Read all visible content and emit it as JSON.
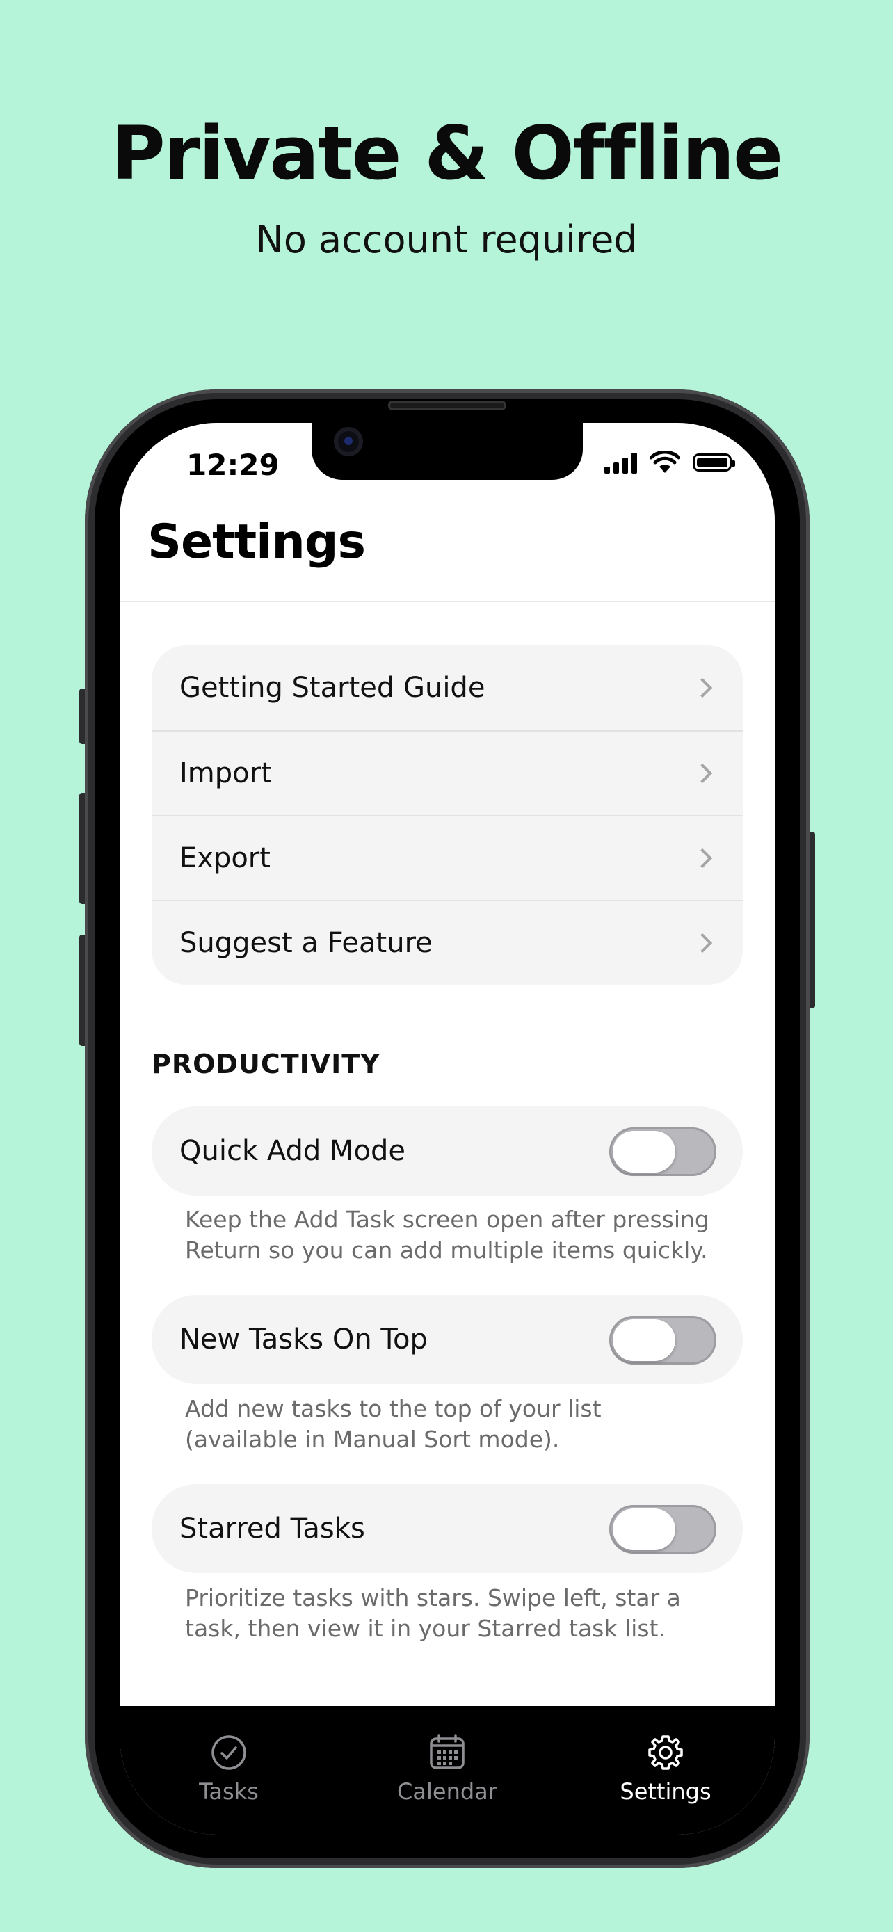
{
  "promo": {
    "headline": "Private & Offline",
    "subhead": "No account required"
  },
  "status_bar": {
    "time": "12:29",
    "icons": [
      "cellular-signal-icon",
      "wifi-icon",
      "battery-icon"
    ]
  },
  "screen": {
    "title": "Settings",
    "menu_items": [
      {
        "label": "Getting Started Guide",
        "icon": "chevron-right-icon"
      },
      {
        "label": "Import",
        "icon": "chevron-right-icon"
      },
      {
        "label": "Export",
        "icon": "chevron-right-icon"
      },
      {
        "label": "Suggest a Feature",
        "icon": "chevron-right-icon"
      }
    ],
    "productivity": {
      "header": "PRODUCTIVITY",
      "settings": [
        {
          "label": "Quick Add Mode",
          "enabled": false,
          "note": "Keep the Add Task screen open after pressing Return so you can add multiple items quickly."
        },
        {
          "label": "New Tasks On Top",
          "enabled": false,
          "note": "Add new tasks to the top of your list (available in Manual Sort mode)."
        },
        {
          "label": "Starred Tasks",
          "enabled": false,
          "note": "Prioritize tasks with stars. Swipe left, star a task, then view it in your Starred task list."
        }
      ]
    }
  },
  "tab_bar": {
    "tabs": [
      {
        "label": "Tasks",
        "icon": "checkmark-circle-icon",
        "active": false
      },
      {
        "label": "Calendar",
        "icon": "calendar-icon",
        "active": false
      },
      {
        "label": "Settings",
        "icon": "gear-icon",
        "active": true
      }
    ]
  },
  "colors": {
    "background": "#b5f4d8",
    "card": "#f4f4f4",
    "toggle_off": "#b8b8bd",
    "tab_active": "#ffffff",
    "tab_inactive": "#8e8e93"
  }
}
